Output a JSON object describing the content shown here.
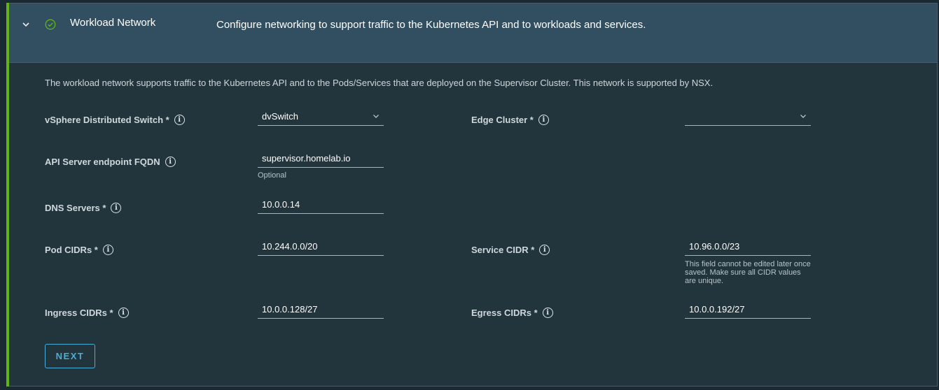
{
  "header": {
    "title": "Workload Network",
    "description": "Configure networking to support traffic to the Kubernetes API and to workloads and services."
  },
  "intro": "The workload network supports traffic to the Kubernetes API and to the Pods/Services that are deployed on the Supervisor Cluster. This network is supported by NSX.",
  "fields": {
    "vds": {
      "label": "vSphere Distributed Switch *",
      "value": "dvSwitch"
    },
    "edge_cluster": {
      "label": "Edge Cluster *",
      "value": ""
    },
    "api_fqdn": {
      "label": "API Server endpoint FQDN",
      "value": "supervisor.homelab.io",
      "helper": "Optional"
    },
    "dns": {
      "label": "DNS Servers *",
      "value": "10.0.0.14"
    },
    "pod_cidrs": {
      "label": "Pod CIDRs *",
      "value": "10.244.0.0/20"
    },
    "service_cidr": {
      "label": "Service CIDR *",
      "value": "10.96.0.0/23",
      "helper": "This field cannot be edited later once saved. Make sure all CIDR values are unique."
    },
    "ingress_cidrs": {
      "label": "Ingress CIDRs *",
      "value": "10.0.0.128/27"
    },
    "egress_cidrs": {
      "label": "Egress CIDRs *",
      "value": "10.0.0.192/27"
    }
  },
  "buttons": {
    "next": "NEXT"
  },
  "icons": {
    "info_glyph": "i",
    "status": "check-circle-icon",
    "expand": "chevron-down-icon"
  },
  "colors": {
    "accent_green": "#60b515",
    "link_blue": "#49afd9",
    "header_bg": "#324f61",
    "panel_bg": "#22343c"
  }
}
